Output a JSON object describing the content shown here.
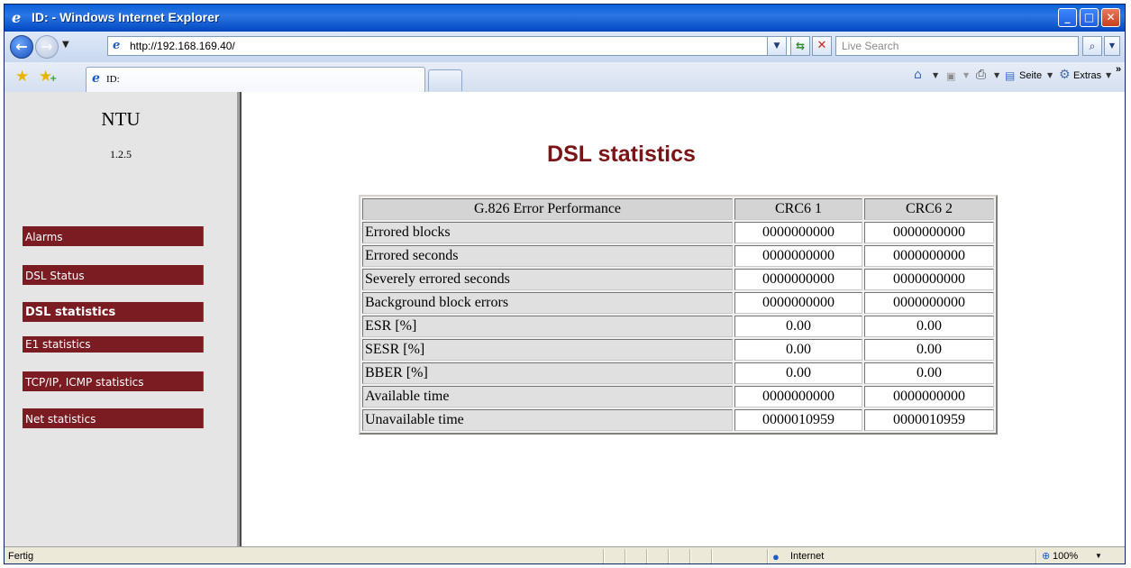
{
  "window": {
    "title": "ID: - Windows Internet Explorer"
  },
  "toolbar": {
    "address": "http://192.168.169.40/",
    "search_placeholder": "Live Search"
  },
  "tabs": [
    {
      "label": "ID:"
    }
  ],
  "commands": {
    "page": "Seite",
    "extras": "Extras",
    "more": "»"
  },
  "sidebar": {
    "brand": "NTU",
    "version": "1.2.5",
    "items": [
      {
        "label": "Alarms",
        "active": false
      },
      {
        "label": "DSL Status",
        "active": false
      },
      {
        "label": "DSL statistics",
        "active": true
      },
      {
        "label": "E1 statistics",
        "active": false
      },
      {
        "label": "TCP/IP, ICMP statistics",
        "active": false
      },
      {
        "label": "Net statistics",
        "active": false
      }
    ]
  },
  "main": {
    "title": "DSL statistics",
    "table": {
      "headers": [
        "G.826 Error Performance",
        "CRC6 1",
        "CRC6 2"
      ],
      "rows": [
        [
          "Errored blocks",
          "0000000000",
          "0000000000"
        ],
        [
          "Errored seconds",
          "0000000000",
          "0000000000"
        ],
        [
          "Severely errored seconds",
          "0000000000",
          "0000000000"
        ],
        [
          "Background block errors",
          "0000000000",
          "0000000000"
        ],
        [
          "ESR [%]",
          "0.00",
          "0.00"
        ],
        [
          "SESR [%]",
          "0.00",
          "0.00"
        ],
        [
          "BBER [%]",
          "0.00",
          "0.00"
        ],
        [
          "Available time",
          "0000000000",
          "0000000000"
        ],
        [
          "Unavailable time",
          "0000010959",
          "0000010959"
        ]
      ]
    }
  },
  "statusbar": {
    "status": "Fertig",
    "zone": "Internet",
    "zoom": "100%"
  },
  "colors": {
    "menu_bg": "#7a1c22",
    "title_color": "#7a1416",
    "titlebar_blue": "#0a5fd8"
  }
}
